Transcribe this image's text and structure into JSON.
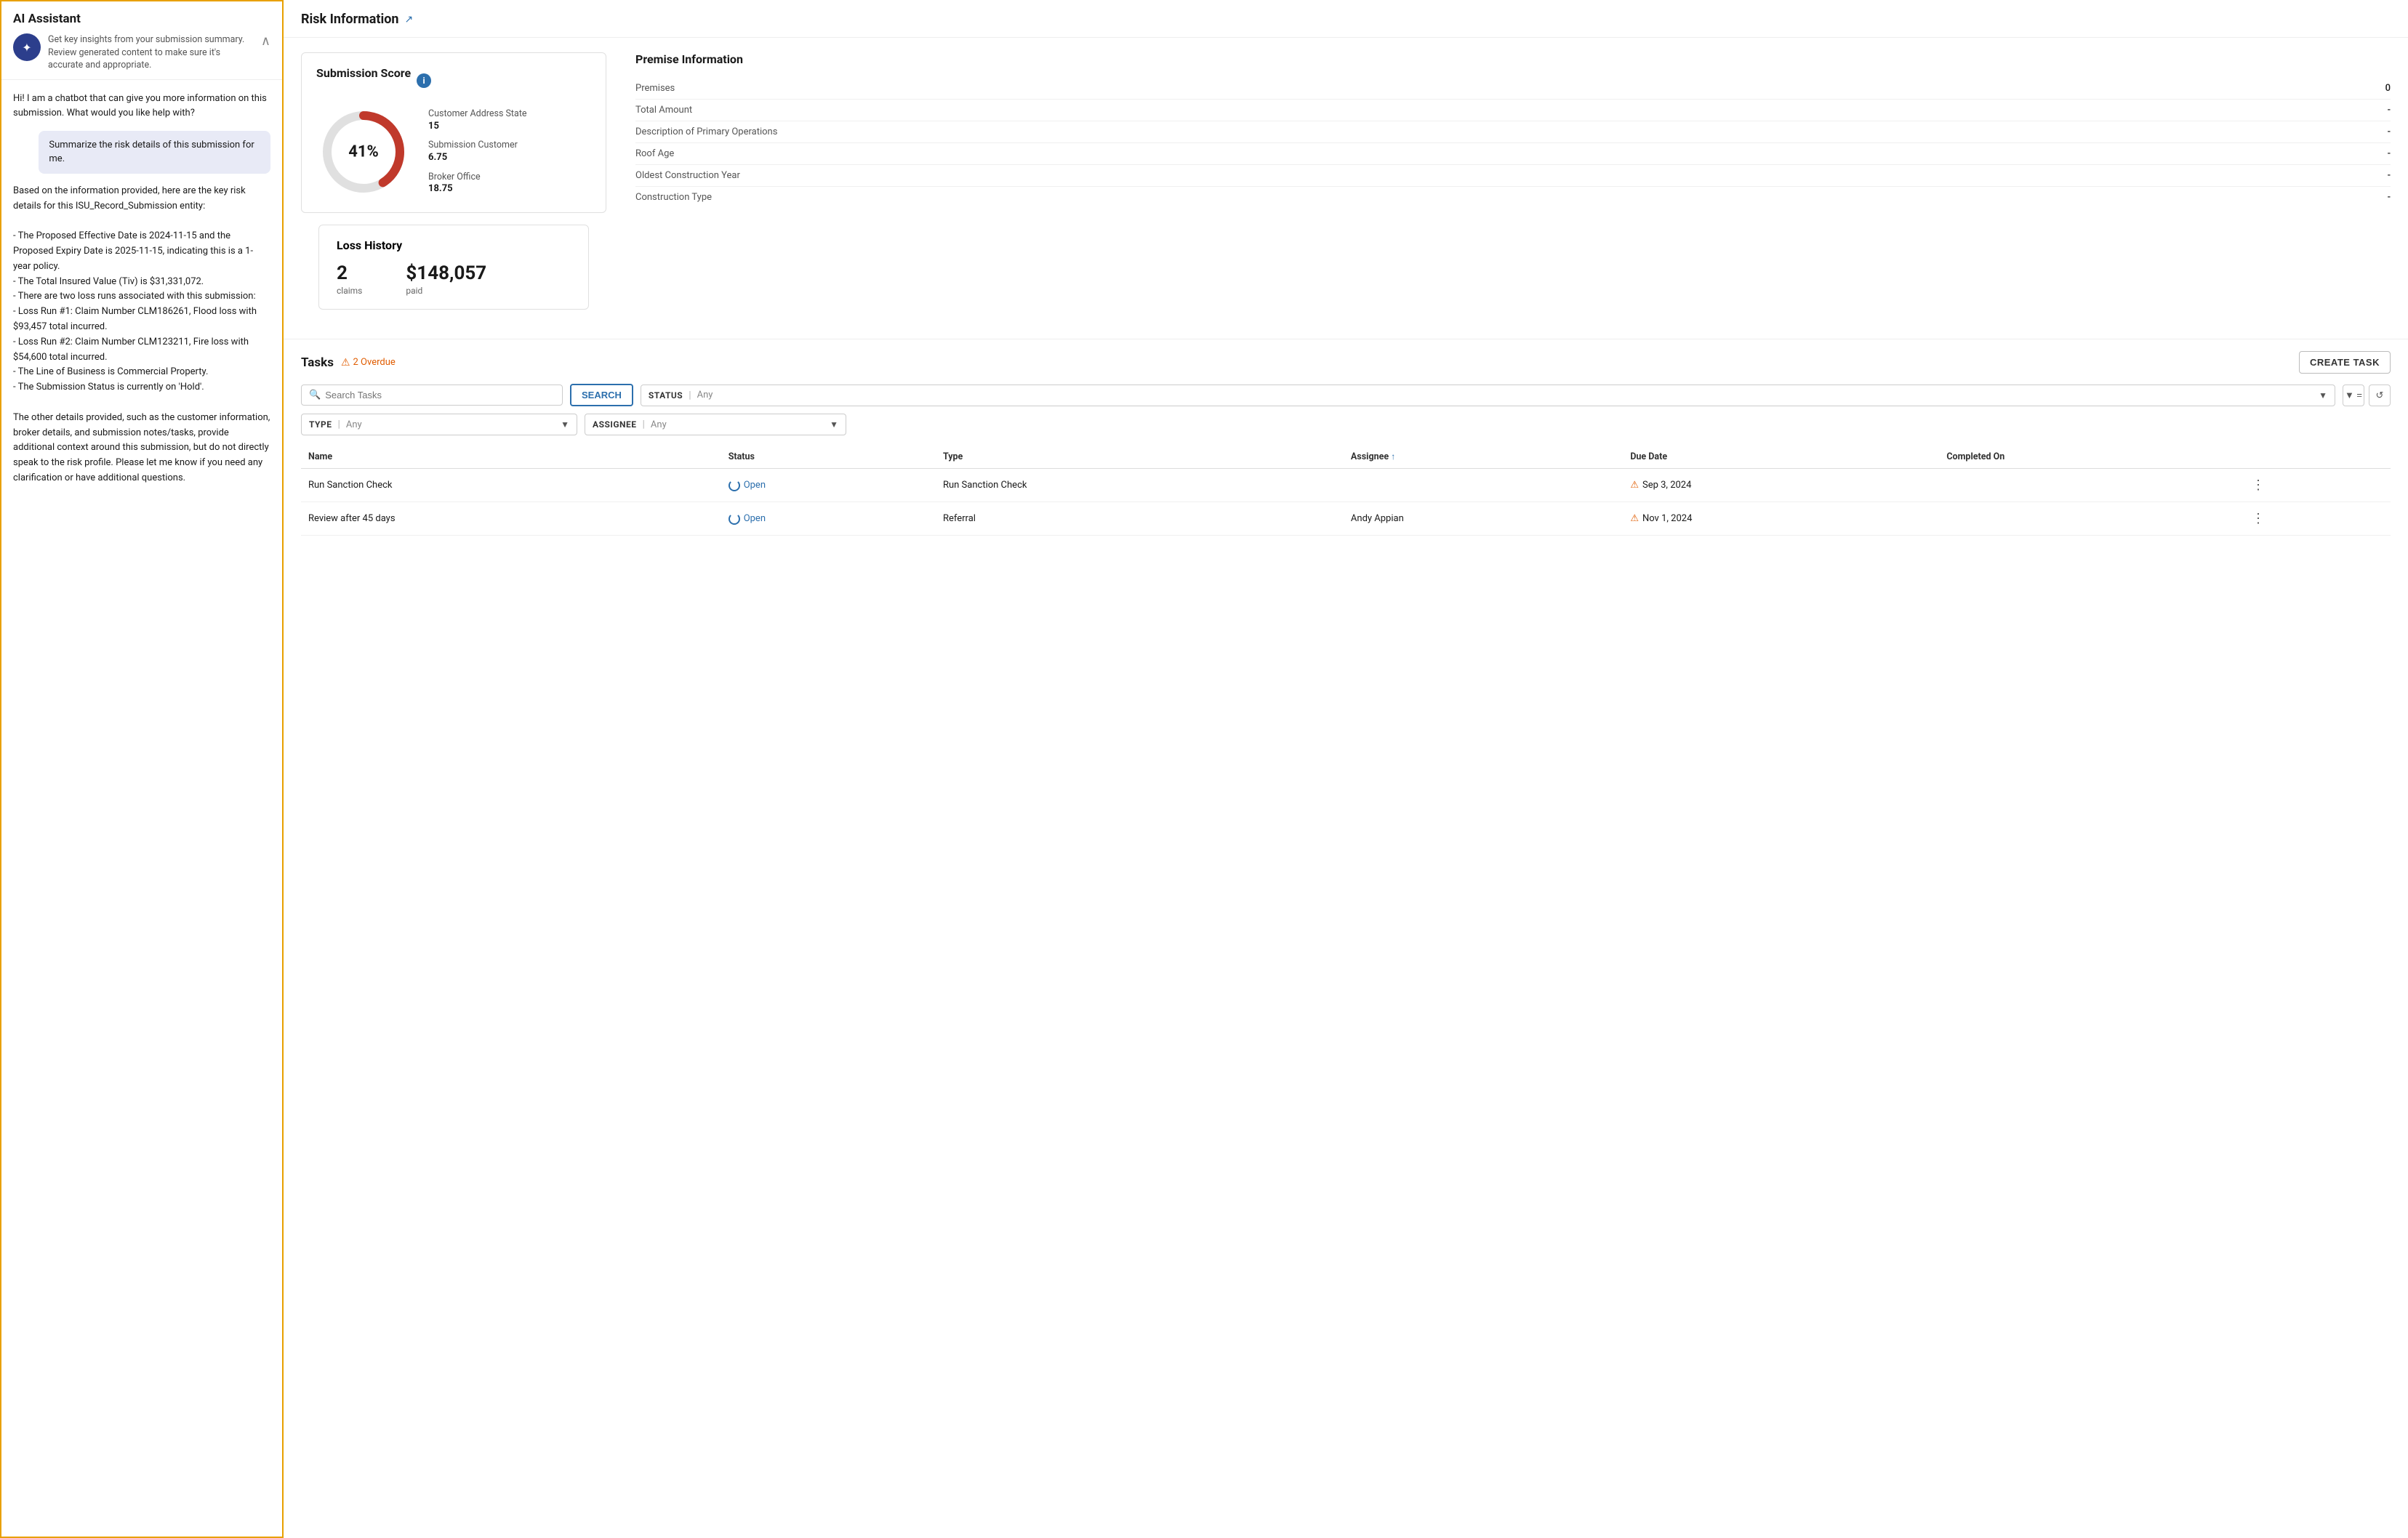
{
  "ai_panel": {
    "title": "AI Assistant",
    "avatar_icon": "✦",
    "subtitle": "Get key insights from your submission summary. Review generated content to make sure it's accurate and appropriate.",
    "collapse_icon": "∧",
    "messages": [
      {
        "type": "bot",
        "text": "Hi! I am a chatbot that can give you more information on this submission. What would you like help with?"
      },
      {
        "type": "user",
        "text": "Summarize the risk details of this submission for me."
      },
      {
        "type": "bot",
        "text": "Based on the information provided, here are the key risk details for this ISU_Record_Submission entity:\n\n- The Proposed Effective Date is 2024-11-15 and the Proposed Expiry Date is 2025-11-15, indicating this is a 1-year policy.\n- The Total Insured Value (Tiv) is $31,331,072.\n- There are two loss runs associated with this submission:\n   - Loss Run #1: Claim Number CLM186261, Flood loss with $93,457 total incurred.\n   - Loss Run #2: Claim Number CLM123211, Fire loss with $54,600 total incurred.\n- The Line of Business is Commercial Property.\n- The Submission Status is currently on 'Hold'.\n\nThe other details provided, such as the customer information, broker details, and submission notes/tasks, provide additional context around this submission, but do not directly speak to the risk profile. Please let me know if you need any clarification or have additional questions."
      }
    ]
  },
  "risk_info": {
    "title": "Risk Information",
    "expand_icon": "↗",
    "submission_score": {
      "label": "Submission Score",
      "info_icon": "i",
      "percent": "41%",
      "percent_num": 41,
      "details": [
        {
          "label": "Customer Address State",
          "value": "15"
        },
        {
          "label": "Submission Customer",
          "value": "6.75"
        },
        {
          "label": "Broker Office",
          "value": "18.75"
        }
      ]
    },
    "premise_info": {
      "title": "Premise Information",
      "rows": [
        {
          "label": "Premises",
          "value": "0"
        },
        {
          "label": "Total Amount",
          "value": "-"
        },
        {
          "label": "Description of Primary Operations",
          "value": "-"
        },
        {
          "label": "Roof Age",
          "value": "-"
        },
        {
          "label": "Oldest Construction Year",
          "value": "-"
        },
        {
          "label": "Construction Type",
          "value": "-"
        }
      ]
    },
    "loss_history": {
      "title": "Loss History",
      "claims_count": "2",
      "claims_label": "claims",
      "paid_amount": "$148,057",
      "paid_label": "paid"
    }
  },
  "tasks": {
    "title": "Tasks",
    "overdue_icon": "⚠",
    "overdue_count": "2 Overdue",
    "create_task_label": "CREATE TASK",
    "search_placeholder": "Search Tasks",
    "search_button_label": "SEARCH",
    "status_filter_label": "STATUS",
    "status_filter_value": "Any",
    "type_filter_label": "TYPE",
    "type_filter_value": "Any",
    "assignee_filter_label": "ASSIGNEE",
    "assignee_filter_value": "Any",
    "columns": [
      {
        "label": "Name",
        "sortable": false
      },
      {
        "label": "Status",
        "sortable": false
      },
      {
        "label": "Type",
        "sortable": false
      },
      {
        "label": "Assignee",
        "sortable": true
      },
      {
        "label": "Due Date",
        "sortable": false
      },
      {
        "label": "Completed On",
        "sortable": false
      }
    ],
    "rows": [
      {
        "name": "Run Sanction Check",
        "status": "Open",
        "type": "Run Sanction Check",
        "assignee": "",
        "due_date": "Sep 3, 2024",
        "overdue": true,
        "completed_on": ""
      },
      {
        "name": "Review after 45 days",
        "status": "Open",
        "type": "Referral",
        "assignee": "Andy Appian",
        "due_date": "Nov 1, 2024",
        "overdue": true,
        "completed_on": ""
      }
    ]
  }
}
